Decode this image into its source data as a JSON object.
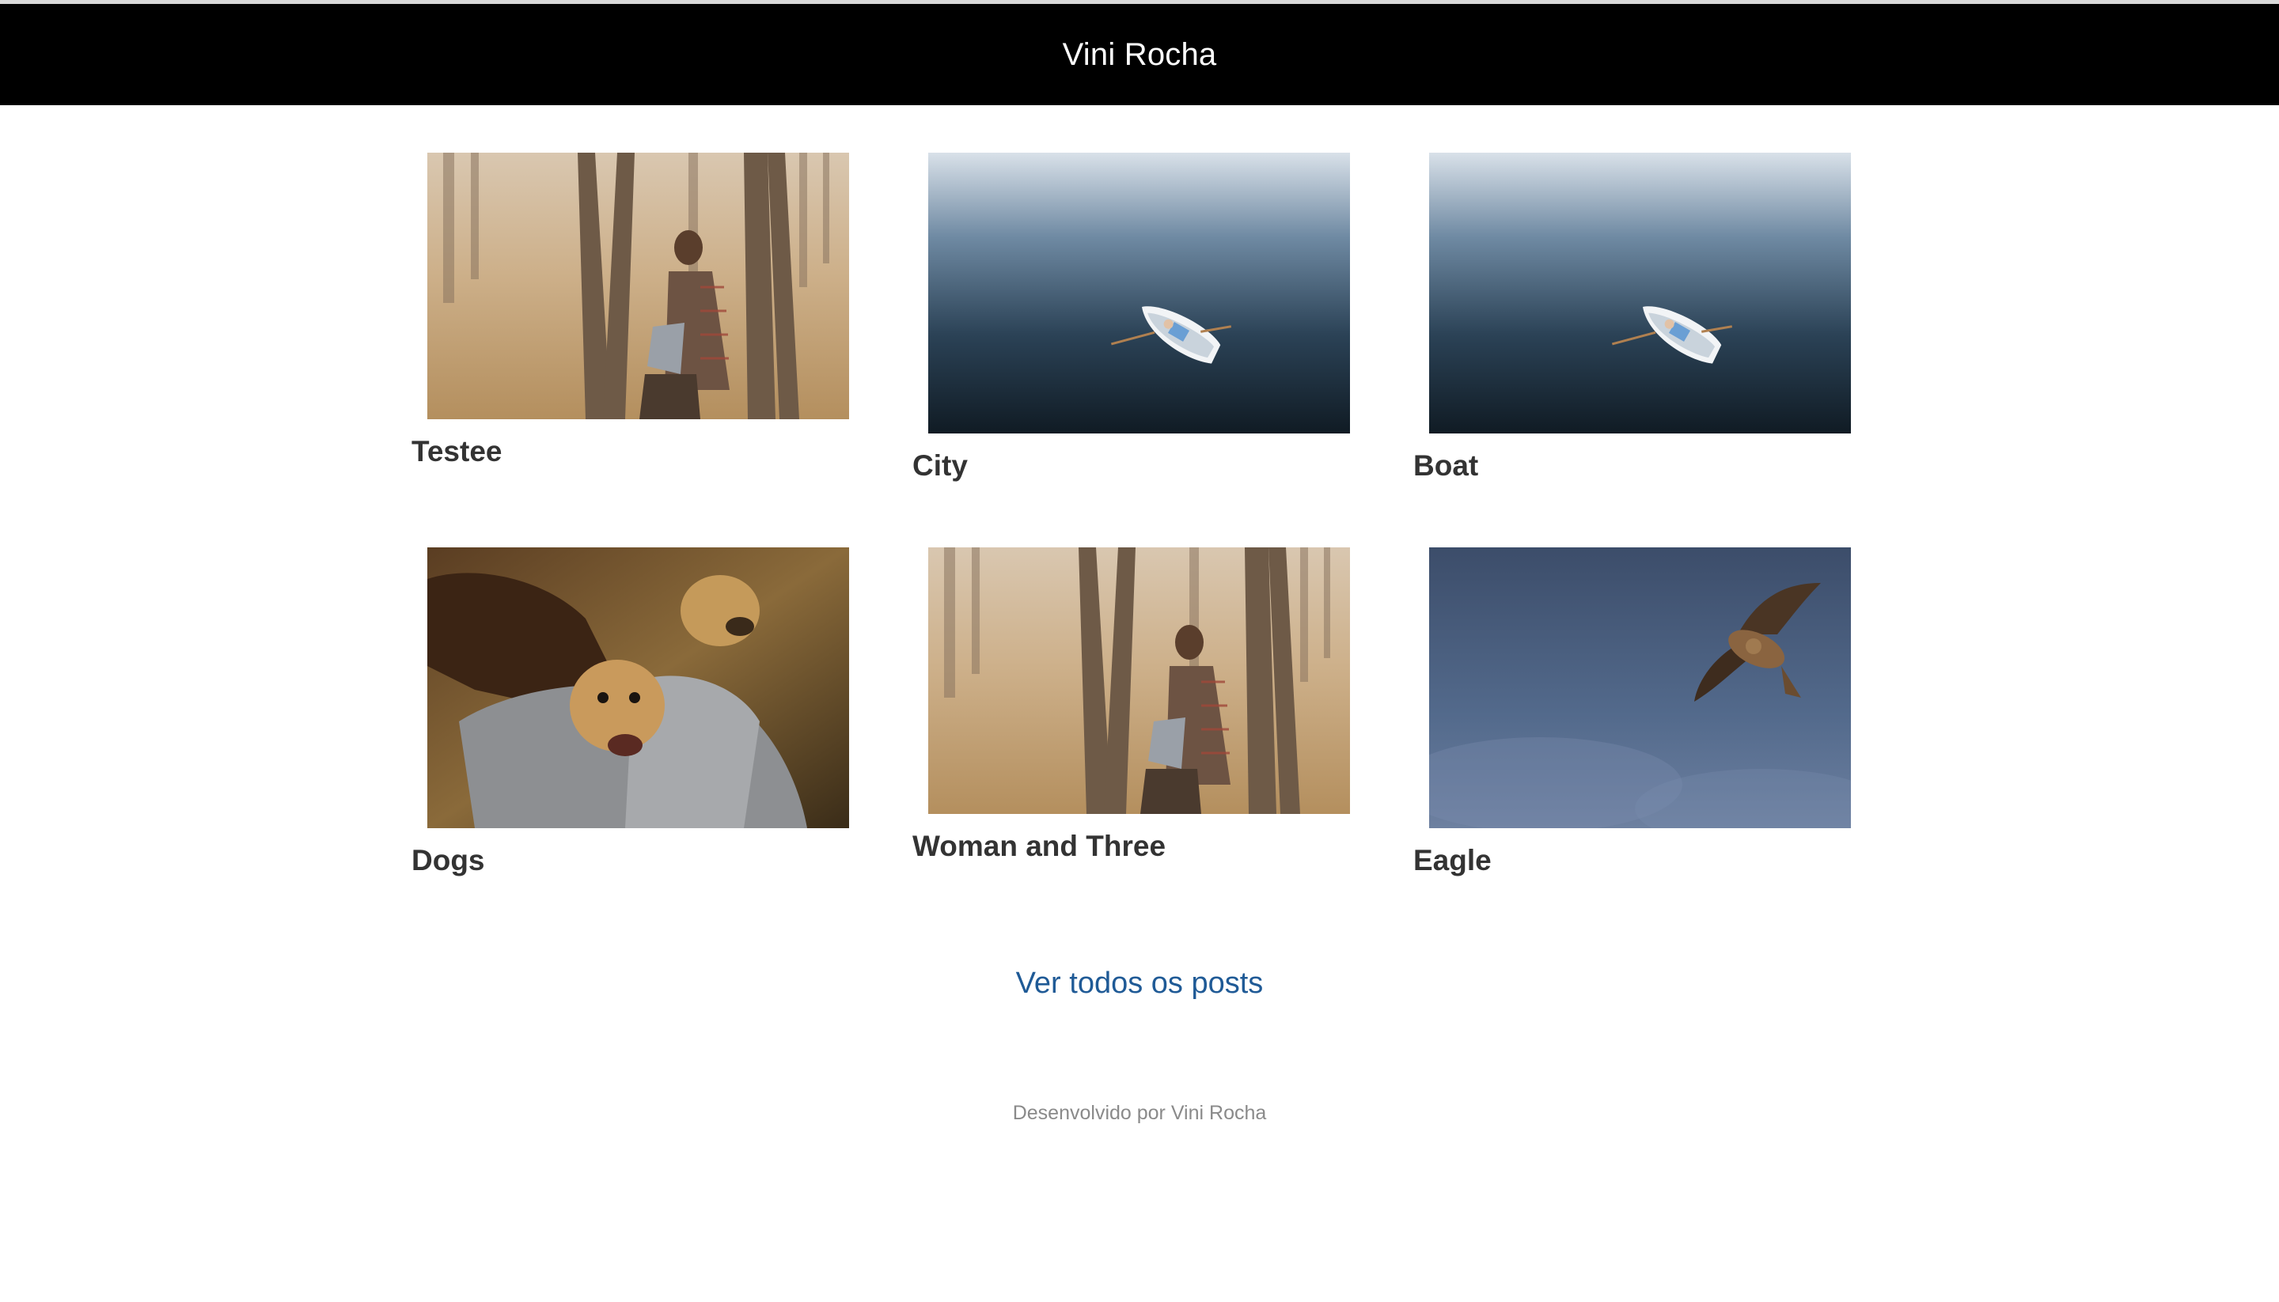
{
  "header": {
    "title": "Vini Rocha"
  },
  "posts": [
    {
      "title": "Testee",
      "image": "woman-in-forest"
    },
    {
      "title": "City",
      "image": "boat-on-water"
    },
    {
      "title": "Boat",
      "image": "boat-on-water"
    },
    {
      "title": "Dogs",
      "image": "puppies-in-bag"
    },
    {
      "title": "Woman and Three",
      "image": "woman-in-forest"
    },
    {
      "title": "Eagle",
      "image": "eagle-in-sky"
    }
  ],
  "more_link": "Ver todos os posts",
  "footer": "Desenvolvido por Vini Rocha"
}
